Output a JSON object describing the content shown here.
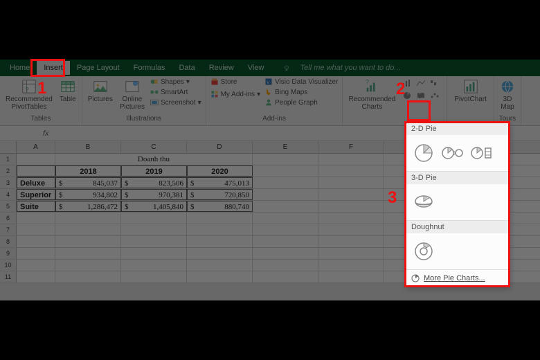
{
  "tabs": {
    "home": "Home",
    "insert": "Insert",
    "page_layout": "Page Layout",
    "formulas": "Formulas",
    "data": "Data",
    "review": "Review",
    "view": "View",
    "tell_me": "Tell me what you want to do..."
  },
  "ribbon": {
    "tables": {
      "rec_pivot": "Recommended\nPivotTables",
      "table": "Table",
      "label": "Tables"
    },
    "illus": {
      "pictures": "Pictures",
      "online_pictures": "Online\nPictures",
      "shapes": "Shapes",
      "smartart": "SmartArt",
      "screenshot": "Screenshot",
      "label": "Illustrations"
    },
    "addins": {
      "store": "Store",
      "myaddins": "My Add-ins",
      "visio": "Visio Data Visualizer",
      "bing": "Bing Maps",
      "people": "People Graph",
      "label": "Add-ins"
    },
    "charts": {
      "recommended": "Recommended\nCharts"
    },
    "pivotchart": "PivotChart",
    "tours": {
      "map3d": "3D\nMap",
      "label": "Tours"
    }
  },
  "sheet": {
    "title": "Doanh thu",
    "headers": [
      "2018",
      "2019",
      "2020"
    ],
    "rows": [
      {
        "name": "Deluxe",
        "vals": [
          "845,037",
          "823,506",
          "475,013"
        ]
      },
      {
        "name": "Superior",
        "vals": [
          "934,802",
          "970,381",
          "720,850"
        ]
      },
      {
        "name": "Suite",
        "vals": [
          "1,286,472",
          "1,405,840",
          "880,740"
        ]
      }
    ]
  },
  "popup": {
    "sec1": "2-D Pie",
    "sec2": "3-D Pie",
    "sec3": "Doughnut",
    "more": "More Pie Charts..."
  },
  "callouts": {
    "n1": "1",
    "n2": "2",
    "n3": "3"
  },
  "currency": "$"
}
